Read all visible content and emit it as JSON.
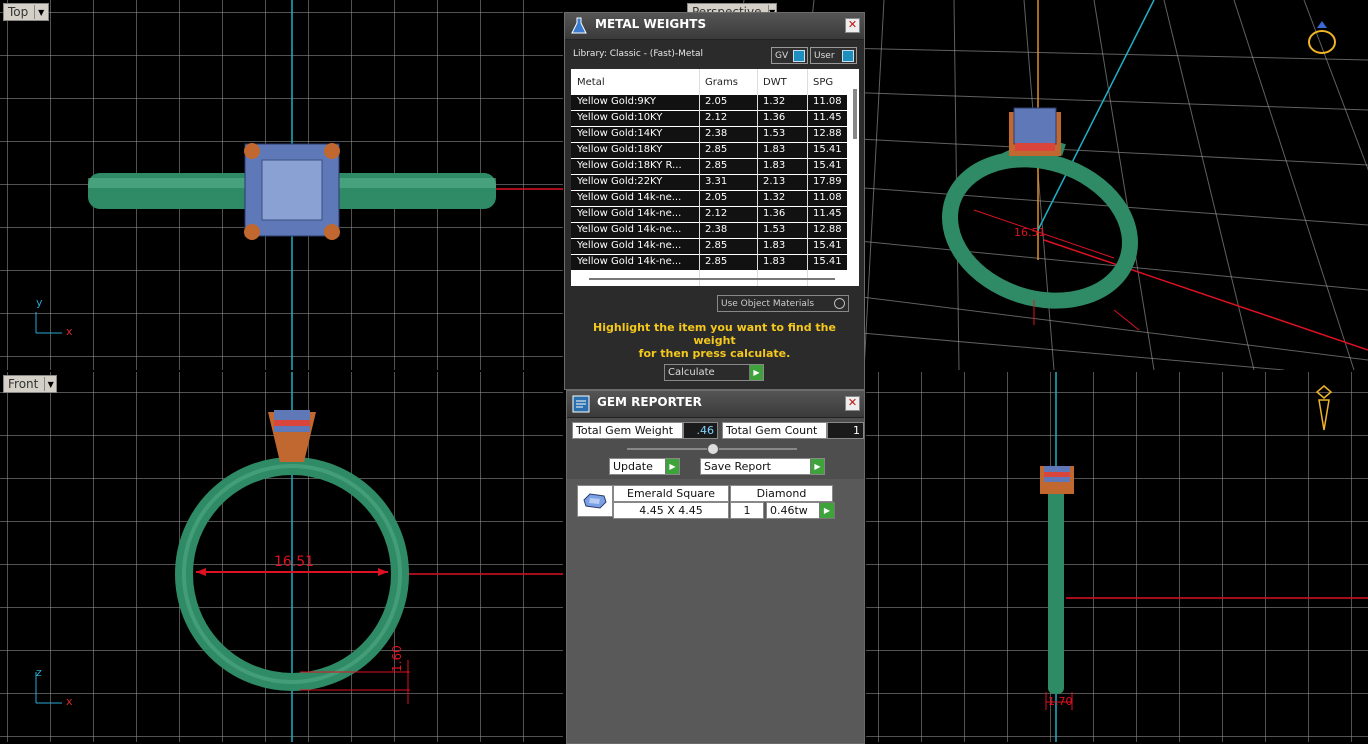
{
  "viewports": {
    "top": {
      "label": "Top",
      "axis_y": "y",
      "axis_x": "x"
    },
    "perspective": {
      "label": "Perspective"
    },
    "front": {
      "label": "Front",
      "axis_z": "z",
      "axis_x": "x",
      "dim_width": "16.51",
      "dim_height": "1.60"
    },
    "side": {
      "dim_width": "1.70"
    }
  },
  "metal_weights": {
    "title": "METAL WEIGHTS",
    "library": "Library: Classic - (Fast)-Metal",
    "gv_toggle": "GV",
    "user_toggle": "User",
    "columns": [
      "Metal",
      "Grams",
      "DWT",
      "SPG"
    ],
    "rows": [
      [
        "Yellow Gold:9KY",
        "2.05",
        "1.32",
        "11.08"
      ],
      [
        "Yellow Gold:10KY",
        "2.12",
        "1.36",
        "11.45"
      ],
      [
        "Yellow Gold:14KY",
        "2.38",
        "1.53",
        "12.88"
      ],
      [
        "Yellow Gold:18KY",
        "2.85",
        "1.83",
        "15.41"
      ],
      [
        "Yellow Gold:18KY R...",
        "2.85",
        "1.83",
        "15.41"
      ],
      [
        "Yellow Gold:22KY",
        "3.31",
        "2.13",
        "17.89"
      ],
      [
        "Yellow Gold 14k-ne...",
        "2.05",
        "1.32",
        "11.08"
      ],
      [
        "Yellow Gold 14k-ne...",
        "2.12",
        "1.36",
        "11.45"
      ],
      [
        "Yellow Gold 14k-ne...",
        "2.38",
        "1.53",
        "12.88"
      ],
      [
        "Yellow Gold 14k-ne...",
        "2.85",
        "1.83",
        "15.41"
      ],
      [
        "Yellow Gold 14k-ne...",
        "2.85",
        "1.83",
        "15.41"
      ]
    ],
    "materials_select": "Use Object Materials",
    "hint_line1": "Highlight the item you want to find the weight",
    "hint_line2": "for then press calculate.",
    "calculate": "Calculate"
  },
  "gem_reporter": {
    "title": "GEM REPORTER",
    "total_weight_label": "Total Gem Weight",
    "total_weight_value": ".46",
    "total_count_label": "Total Gem Count",
    "total_count_value": "1",
    "update": "Update",
    "save_report": "Save Report",
    "gem": {
      "shape": "Emerald Square",
      "type": "Diamond",
      "size": "4.45 X 4.45",
      "count": "1",
      "weight": "0.46tw"
    }
  }
}
